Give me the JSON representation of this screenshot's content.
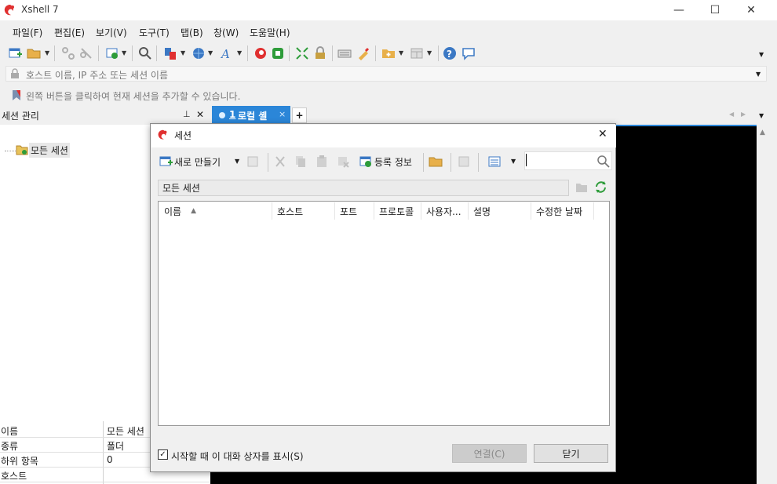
{
  "window": {
    "title": "Xshell 7",
    "controls": {
      "minimize": "—",
      "maximize": "☐",
      "close": "✕"
    }
  },
  "menu": [
    "파일(F)",
    "편집(E)",
    "보기(V)",
    "도구(T)",
    "탭(B)",
    "창(W)",
    "도움말(H)"
  ],
  "address_bar": {
    "placeholder": "호스트 이름, IP 주소 또는 세션 이름"
  },
  "hint": "왼쪽 버튼을 클릭하여 현재 세션을 추가할 수 있습니다.",
  "session_panel": {
    "title": "세션 관리",
    "pin": "⊥",
    "close": "✕",
    "tree_root": "모든 세션",
    "properties": [
      {
        "key": "이름",
        "value": "모든 세션"
      },
      {
        "key": "종류",
        "value": "폴더"
      },
      {
        "key": "하위 항목",
        "value": "0"
      },
      {
        "key": "호스트",
        "value": ""
      }
    ]
  },
  "tabs": [
    {
      "number": "1",
      "label": "로컬 셸",
      "close": "×"
    }
  ],
  "tab_add": "+",
  "dialog": {
    "title": "세션",
    "close": "✕",
    "toolbar": {
      "new_label": "새로 만들기",
      "properties_label": "등록 정보"
    },
    "search": {
      "value": ""
    },
    "path": "모든 세션",
    "columns": [
      "이름",
      "호스트",
      "포트",
      "프로토콜",
      "사용자...",
      "설명",
      "수정한 날짜"
    ],
    "sort_indicator": "▲",
    "show_on_startup": "시작할 때 이 대화 상자를 표시(S)",
    "show_on_startup_checked": true,
    "connect_button": "연결(C)",
    "close_button": "닫기"
  },
  "colors": {
    "accent": "#2b86d8",
    "brand_red": "#e03030",
    "terminal_bg": "#000000",
    "refresh_green": "#2e9c3a"
  }
}
